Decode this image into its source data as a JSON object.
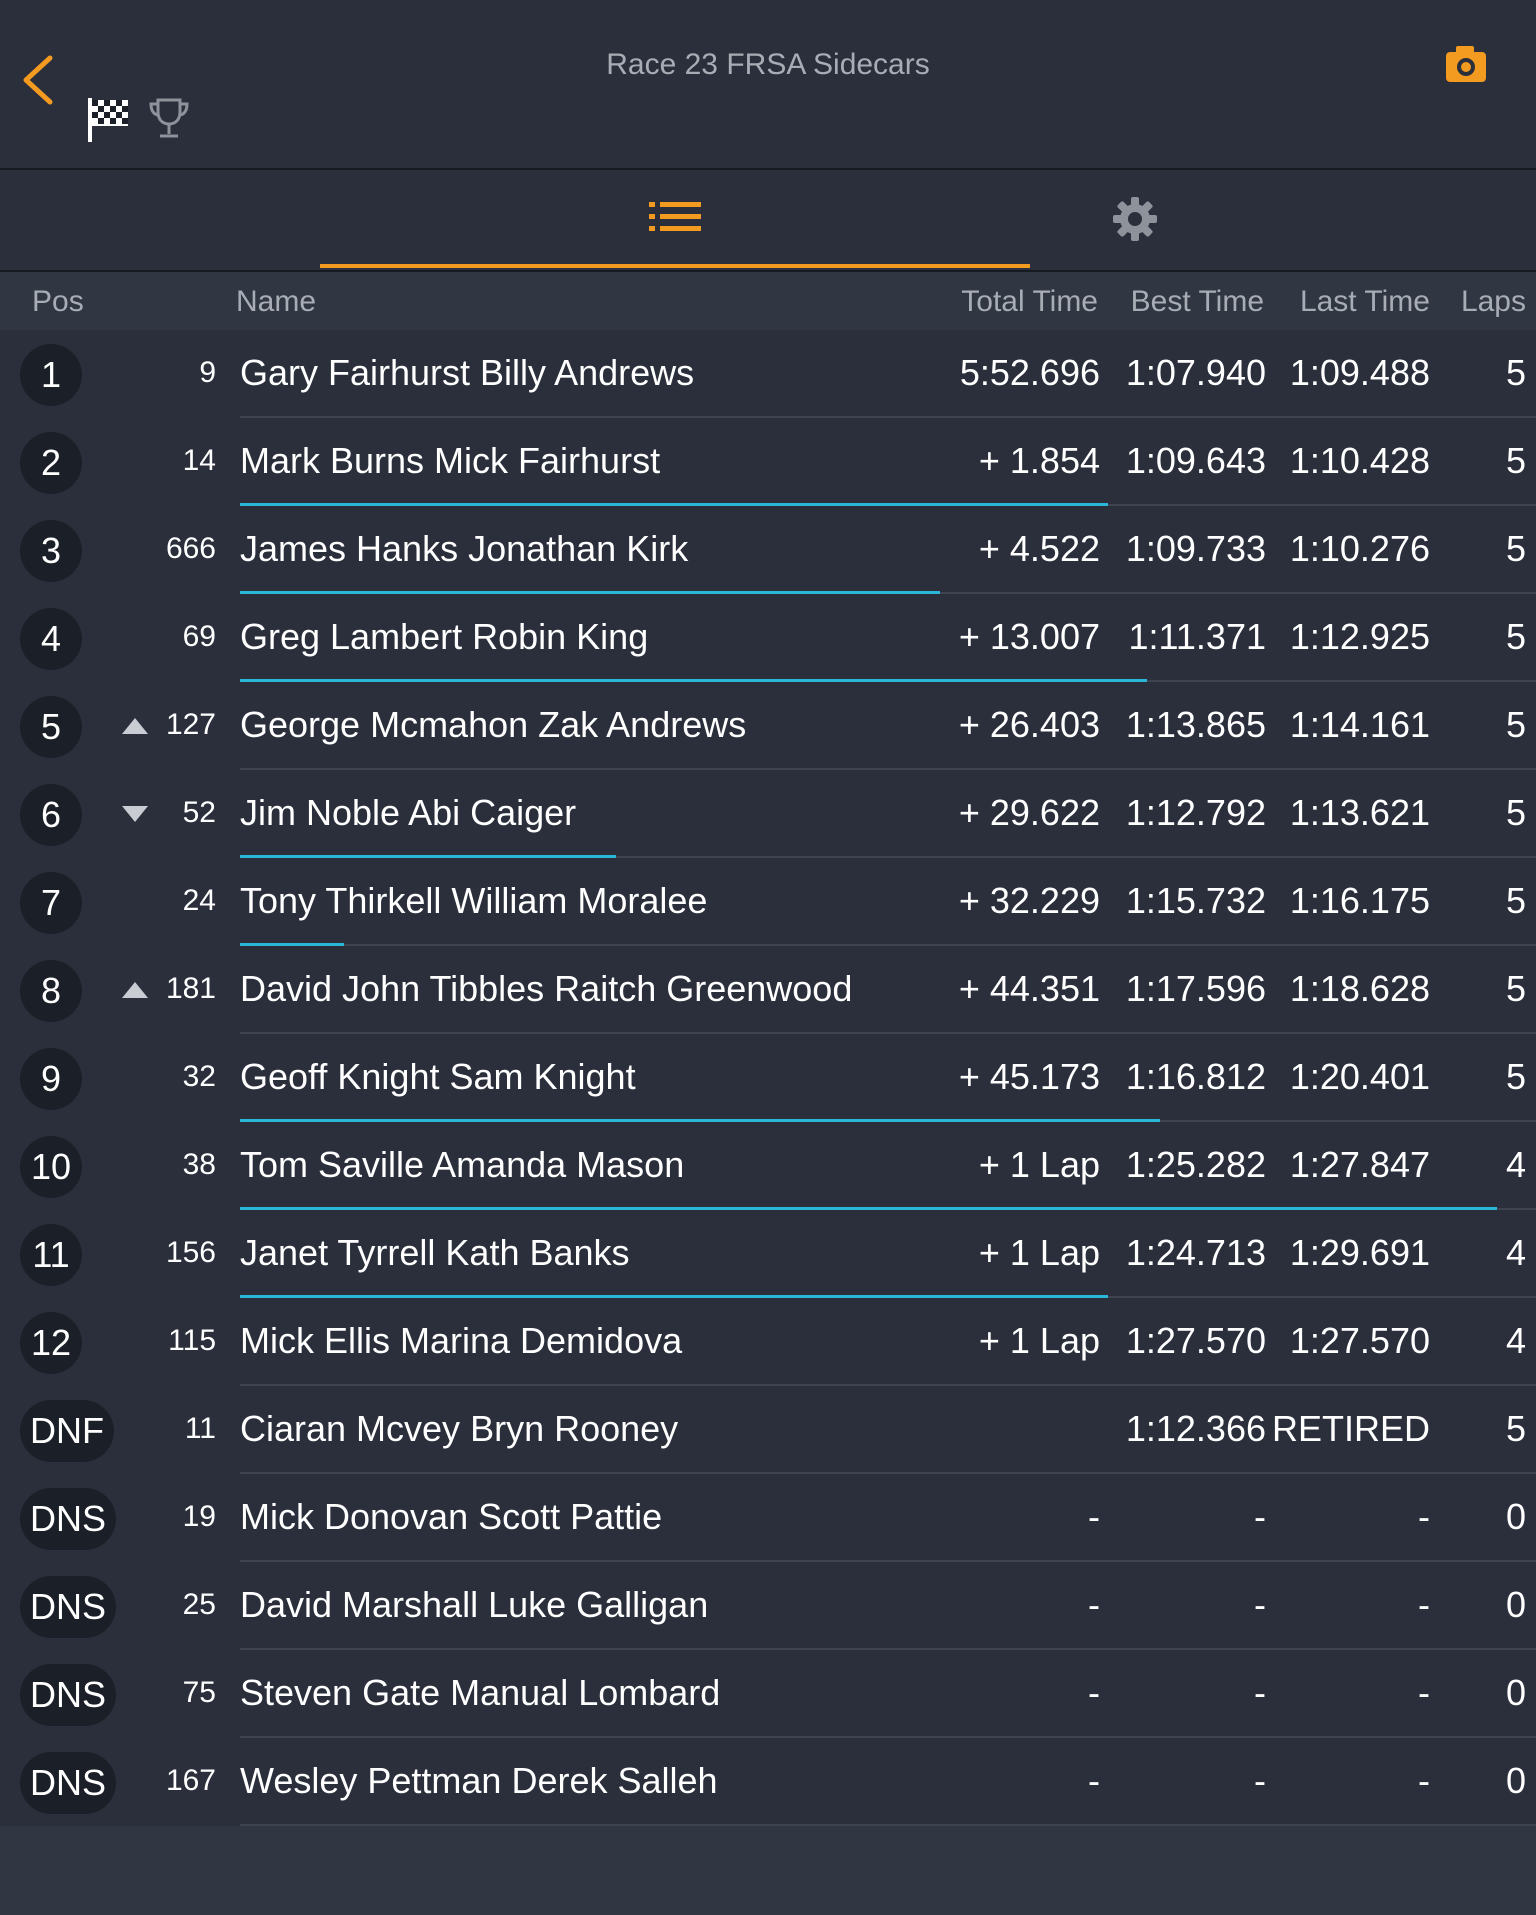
{
  "header": {
    "title": "Race 23 FRSA Sidecars",
    "accent_color": "#f39a21",
    "icons": [
      "chevron-left-icon",
      "checkered-flag-icon",
      "trophy-icon",
      "camera-icon"
    ]
  },
  "tabs": [
    {
      "icon": "list-icon",
      "selected": true
    },
    {
      "icon": "gear-icon",
      "selected": false
    }
  ],
  "columns": {
    "pos": "Pos",
    "name": "Name",
    "total": "Total Time",
    "best": "Best Time",
    "last": "Last Time",
    "laps": "Laps"
  },
  "rows": [
    {
      "pos": "1",
      "num": "9",
      "name": "Gary Fairhurst Billy Andrews",
      "total": "5:52.696",
      "best": "1:07.940",
      "last": "1:09.488",
      "laps": "5",
      "trend": "",
      "bar": 0
    },
    {
      "pos": "2",
      "num": "14",
      "name": "Mark Burns Mick Fairhurst",
      "total": "+ 1.854",
      "best": "1:09.643",
      "last": "1:10.428",
      "laps": "5",
      "trend": "",
      "bar": 0.67
    },
    {
      "pos": "3",
      "num": "666",
      "name": "James Hanks Jonathan Kirk",
      "total": "+ 4.522",
      "best": "1:09.733",
      "last": "1:10.276",
      "laps": "5",
      "trend": "",
      "bar": 0.54
    },
    {
      "pos": "4",
      "num": "69",
      "name": "Greg Lambert Robin King",
      "total": "+ 13.007",
      "best": "1:11.371",
      "last": "1:12.925",
      "laps": "5",
      "trend": "",
      "bar": 0.7
    },
    {
      "pos": "5",
      "num": "127",
      "name": "George Mcmahon Zak Andrews",
      "total": "+ 26.403",
      "best": "1:13.865",
      "last": "1:14.161",
      "laps": "5",
      "trend": "up",
      "bar": 0
    },
    {
      "pos": "6",
      "num": "52",
      "name": "Jim Noble Abi Caiger",
      "total": "+ 29.622",
      "best": "1:12.792",
      "last": "1:13.621",
      "laps": "5",
      "trend": "down",
      "bar": 0.29
    },
    {
      "pos": "7",
      "num": "24",
      "name": "Tony Thirkell William Moralee",
      "total": "+ 32.229",
      "best": "1:15.732",
      "last": "1:16.175",
      "laps": "5",
      "trend": "",
      "bar": 0.08
    },
    {
      "pos": "8",
      "num": "181",
      "name": "David John Tibbles Raitch Greenwood",
      "total": "+ 44.351",
      "best": "1:17.596",
      "last": "1:18.628",
      "laps": "5",
      "trend": "up",
      "bar": 0
    },
    {
      "pos": "9",
      "num": "32",
      "name": "Geoff Knight Sam Knight",
      "total": "+ 45.173",
      "best": "1:16.812",
      "last": "1:20.401",
      "laps": "5",
      "trend": "",
      "bar": 0.71
    },
    {
      "pos": "10",
      "num": "38",
      "name": "Tom Saville Amanda Mason",
      "total": "+ 1 Lap",
      "best": "1:25.282",
      "last": "1:27.847",
      "laps": "4",
      "trend": "",
      "bar": 0.97
    },
    {
      "pos": "11",
      "num": "156",
      "name": "Janet Tyrrell Kath Banks",
      "total": "+ 1 Lap",
      "best": "1:24.713",
      "last": "1:29.691",
      "laps": "4",
      "trend": "",
      "bar": 0.67
    },
    {
      "pos": "12",
      "num": "115",
      "name": "Mick Ellis Marina Demidova",
      "total": "+ 1 Lap",
      "best": "1:27.570",
      "last": "1:27.570",
      "laps": "4",
      "trend": "",
      "bar": 0
    },
    {
      "pos": "DNF",
      "num": "11",
      "name": "Ciaran Mcvey Bryn Rooney",
      "total": "",
      "best": "1:12.366",
      "last": "RETIRED",
      "laps": "5",
      "trend": "",
      "bar": 0
    },
    {
      "pos": "DNS",
      "num": "19",
      "name": "Mick Donovan Scott Pattie",
      "total": "-",
      "best": "-",
      "last": "-",
      "laps": "0",
      "trend": "",
      "bar": 0
    },
    {
      "pos": "DNS",
      "num": "25",
      "name": "David Marshall Luke Galligan",
      "total": "-",
      "best": "-",
      "last": "-",
      "laps": "0",
      "trend": "",
      "bar": 0
    },
    {
      "pos": "DNS",
      "num": "75",
      "name": "Steven Gate Manual Lombard",
      "total": "-",
      "best": "-",
      "last": "-",
      "laps": "0",
      "trend": "",
      "bar": 0
    },
    {
      "pos": "DNS",
      "num": "167",
      "name": "Wesley Pettman Derek Salleh",
      "total": "-",
      "best": "-",
      "last": "-",
      "laps": "0",
      "trend": "",
      "bar": 0
    }
  ]
}
